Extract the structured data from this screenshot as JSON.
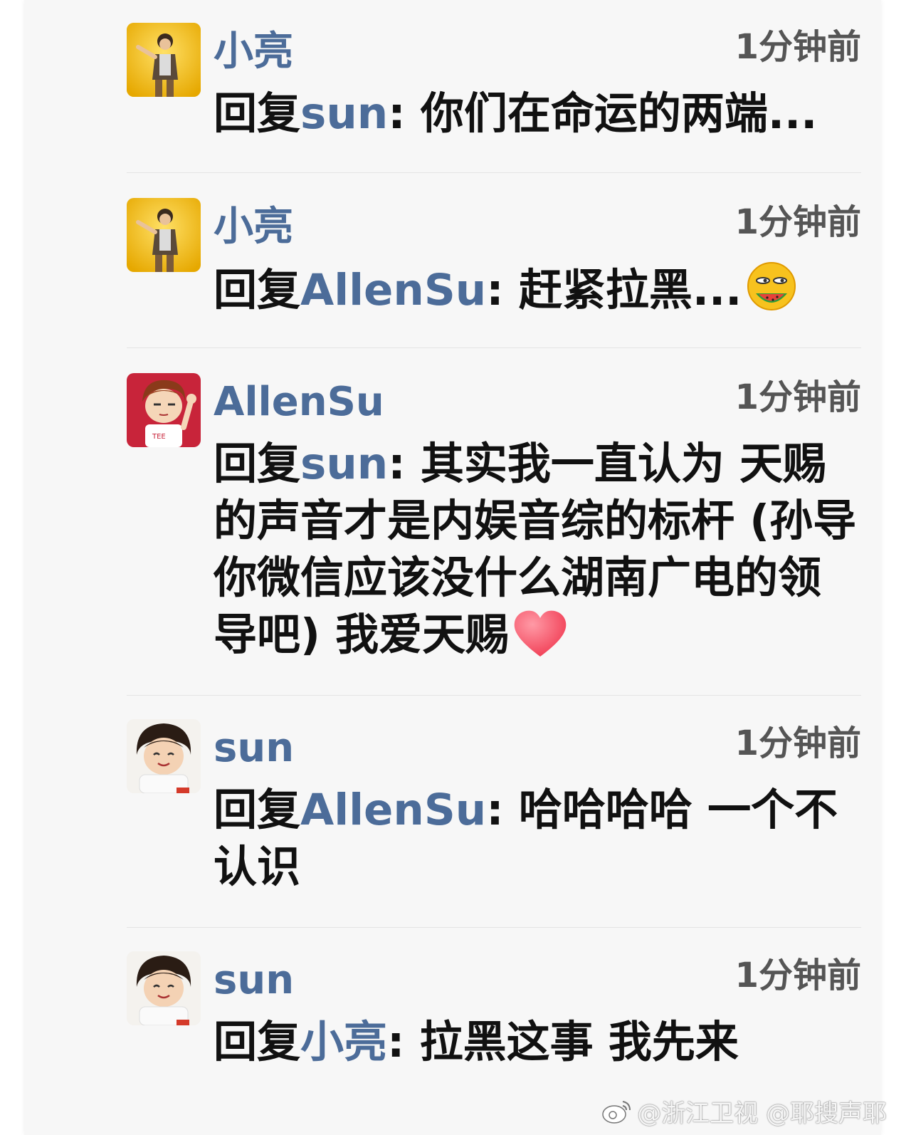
{
  "colors": {
    "name": "#4c6c99",
    "text": "#111111",
    "time": "#555555",
    "divider": "#e4e4e4",
    "background": "#f7f7f7"
  },
  "comments": [
    {
      "user": "小亮",
      "time": "1分钟前",
      "reply_prefix": "回复",
      "mention": "sun",
      "text": ": 你们在命运的两端...",
      "avatar": "singer-avatar"
    },
    {
      "user": "小亮",
      "time": "1分钟前",
      "reply_prefix": "回复",
      "mention": "AllenSu",
      "text": ": 赶紧拉黑...",
      "emoji": "watermelon-eating-face-emoji",
      "avatar": "singer-avatar"
    },
    {
      "user": "AllenSu",
      "time": "1分钟前",
      "reply_prefix": "回复",
      "mention": "sun",
      "text": ": 其实我一直认为 天赐的声音才是内娱音综的标杆 (孙导你微信应该没什么湖南广电的领导吧) 我爱天赐",
      "emoji": "heart-emoji",
      "avatar": "cartoon-boy-avatar"
    },
    {
      "user": "sun",
      "time": "1分钟前",
      "reply_prefix": "回复",
      "mention": "AllenSu",
      "text": ": 哈哈哈哈 一个不认识",
      "avatar": "child-avatar"
    },
    {
      "user": "sun",
      "time": "1分钟前",
      "reply_prefix": "回复",
      "mention": "小亮",
      "text": ": 拉黑这事 我先来",
      "avatar": "child-avatar"
    }
  ],
  "watermark": "@浙江卫视 @耶搜声耶"
}
